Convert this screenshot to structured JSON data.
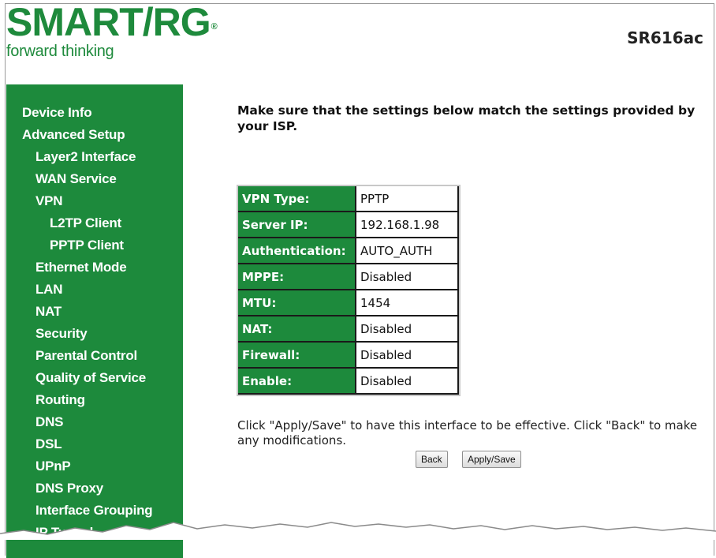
{
  "header": {
    "brand": "SMART/RG",
    "brand_mark": "®",
    "tagline": "forward thinking",
    "model": "SR616ac"
  },
  "sidebar": {
    "items": [
      {
        "label": "Device Info",
        "level": 0
      },
      {
        "label": "Advanced Setup",
        "level": 0
      },
      {
        "label": "Layer2 Interface",
        "level": 1
      },
      {
        "label": "WAN Service",
        "level": 1
      },
      {
        "label": "VPN",
        "level": 1
      },
      {
        "label": "L2TP Client",
        "level": 2
      },
      {
        "label": "PPTP Client",
        "level": 2
      },
      {
        "label": "Ethernet Mode",
        "level": 1
      },
      {
        "label": "LAN",
        "level": 1
      },
      {
        "label": "NAT",
        "level": 1
      },
      {
        "label": "Security",
        "level": 1
      },
      {
        "label": "Parental Control",
        "level": 1
      },
      {
        "label": "Quality of Service",
        "level": 1
      },
      {
        "label": "Routing",
        "level": 1
      },
      {
        "label": "DNS",
        "level": 1
      },
      {
        "label": "DSL",
        "level": 1
      },
      {
        "label": "UPnP",
        "level": 1
      },
      {
        "label": "DNS Proxy",
        "level": 1
      },
      {
        "label": "Interface Grouping",
        "level": 1
      },
      {
        "label": "IP Tunnel",
        "level": 1
      }
    ]
  },
  "main": {
    "intro": "Make sure that the settings below match the settings provided by your ISP.",
    "rows": [
      {
        "key": "VPN Type:",
        "value": "PPTP"
      },
      {
        "key": "Server IP:",
        "value": "192.168.1.98"
      },
      {
        "key": "Authentication:",
        "value": "AUTO_AUTH"
      },
      {
        "key": "MPPE:",
        "value": "Disabled"
      },
      {
        "key": "MTU:",
        "value": "1454"
      },
      {
        "key": "NAT:",
        "value": "Disabled"
      },
      {
        "key": "Firewall:",
        "value": "Disabled"
      },
      {
        "key": "Enable:",
        "value": "Disabled"
      }
    ],
    "note": "Click \"Apply/Save\" to have this interface to be effective. Click \"Back\" to make any modifications.",
    "back_label": "Back",
    "apply_label": "Apply/Save"
  },
  "colors": {
    "brand_green": "#1d8a3c",
    "nav_text": "#ffffff"
  }
}
